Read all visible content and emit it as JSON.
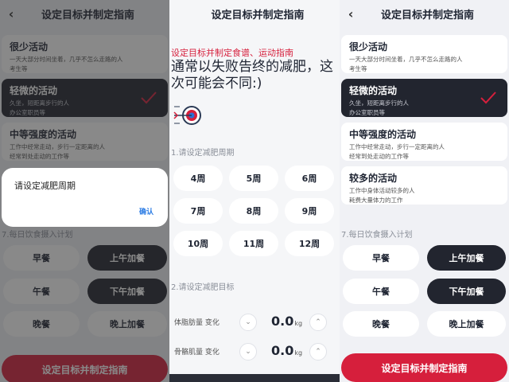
{
  "app": {
    "title": "设定目标并制定指南"
  },
  "activities": [
    {
      "title": "很少活动",
      "desc": "一天大部分时间坐着，几乎不怎么走路的人",
      "example": "考生等"
    },
    {
      "title": "轻微的活动",
      "desc": "久坐，短距离步行的人",
      "example": "办公室职员等"
    },
    {
      "title": "中等强度的活动",
      "desc": "工作中经常走动，步行一定距离的人",
      "example": "经常到处走动的工作等"
    },
    {
      "title": "较多的活动",
      "desc": "工作中身体活动较多的人",
      "example": "耗费大量体力的工作"
    }
  ],
  "selected_activity": "轻微的活动",
  "dialog": {
    "title": "请设定减肥周期",
    "confirm": "确认"
  },
  "meals": {
    "label": "7.每日饮食摄入计划",
    "items": [
      "早餐",
      "上午加餐",
      "午餐",
      "下午加餐",
      "晚餐",
      "晚上加餐"
    ],
    "selected": [
      "上午加餐",
      "下午加餐"
    ]
  },
  "cta_label": "设定目标并制定指南",
  "intro": {
    "red": "设定目标并制定食谱、运动指南",
    "headline": "通常以失败告终的减肥，这次可能会不同:)"
  },
  "period": {
    "label": "1.请设定减肥周期",
    "options": [
      "4周",
      "5周",
      "6周",
      "7周",
      "8周",
      "9周",
      "10周",
      "11周",
      "12周"
    ]
  },
  "goal": {
    "label": "2.请设定减肥目标",
    "rows": [
      {
        "name": "体脂肪量 变化",
        "value": "0.0",
        "unit": "kg"
      },
      {
        "name": "骨骼肌量 变化",
        "value": "0.0",
        "unit": "kg"
      }
    ]
  },
  "icons": {
    "back": "chevron-left-icon",
    "check": "checkmark-icon",
    "minus": "chevron-down-icon",
    "plus": "chevron-up-icon",
    "target": "target-icon"
  },
  "colors": {
    "accent": "#d61f3c",
    "dark": "#22252f",
    "link": "#2a7be4"
  }
}
